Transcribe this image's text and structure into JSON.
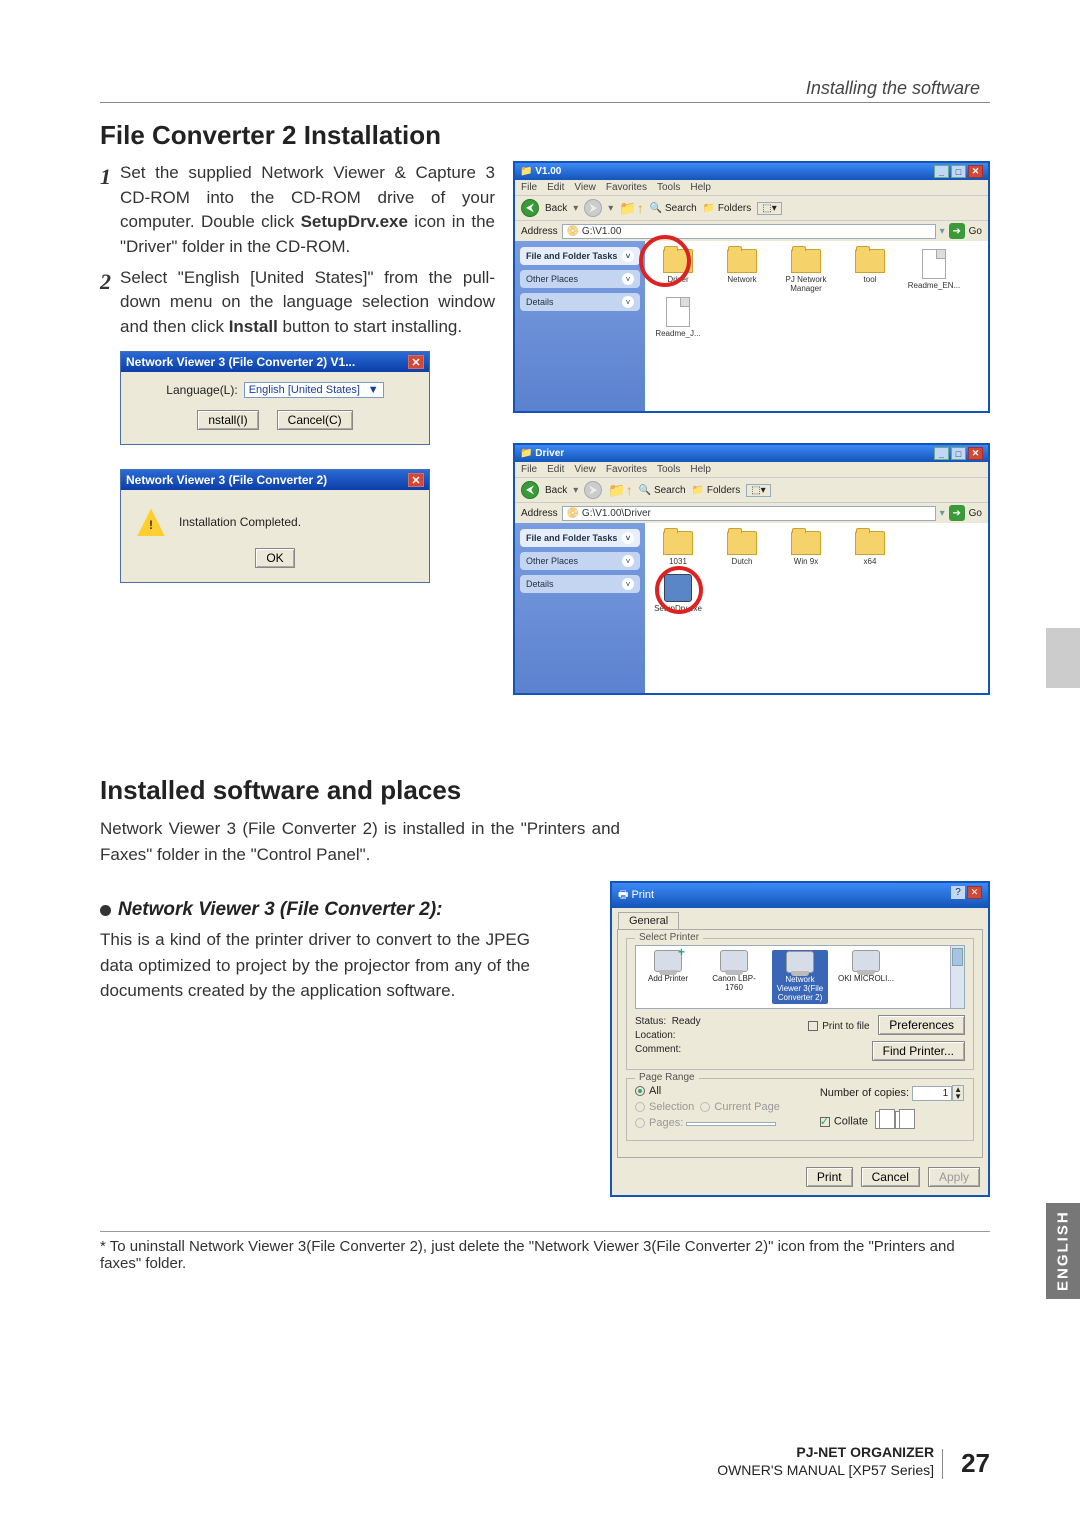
{
  "header": {
    "section": "Installing the software"
  },
  "section1": {
    "title": "File Converter 2 Installation",
    "step1_pre": "Set the supplied Network Viewer & Capture 3 CD-ROM into the CD-ROM drive of your computer. Double click ",
    "step1_bold": "SetupDrv.exe",
    "step1_post": " icon in the \"Driver\" folder in the CD-ROM.",
    "step2_pre": "Select \"English [United States]\" from the pull-down menu on the language selection window and then click ",
    "step2_bold": "Install",
    "step2_post": " button to start installing."
  },
  "dlg_lang": {
    "title": "Network Viewer 3 (File Converter 2) V1...",
    "lang_label": "Language(L):",
    "lang_value": "English [United States]",
    "install": "nstall(I)",
    "cancel": "Cancel(C)"
  },
  "dlg_done": {
    "title": "Network Viewer 3 (File Converter 2)",
    "msg": "Installation Completed.",
    "ok": "OK"
  },
  "explorer_common": {
    "menu": [
      "File",
      "Edit",
      "View",
      "Favorites",
      "Tools",
      "Help"
    ],
    "back": "Back",
    "search": "Search",
    "folders": "Folders",
    "addr_label": "Address",
    "go": "Go",
    "side": {
      "tasks": "File and Folder Tasks",
      "other": "Other Places",
      "details": "Details"
    }
  },
  "exp1": {
    "title": "V1.00",
    "address": "G:\\V1.00",
    "files": [
      {
        "name": "Driver",
        "type": "folder",
        "hi": true
      },
      {
        "name": "Network",
        "type": "folder"
      },
      {
        "name": "PJ Network Manager",
        "type": "folder"
      },
      {
        "name": "tool",
        "type": "folder"
      },
      {
        "name": "Readme_EN...",
        "type": "doc"
      },
      {
        "name": "Readme_J...",
        "type": "doc"
      }
    ]
  },
  "exp2": {
    "title": "Driver",
    "address": "G:\\V1.00\\Driver",
    "files": [
      {
        "name": "1031",
        "type": "folder"
      },
      {
        "name": "Dutch",
        "type": "folder"
      },
      {
        "name": "Win 9x",
        "type": "folder"
      },
      {
        "name": "x64",
        "type": "folder"
      },
      {
        "name": "SetupDrv.exe",
        "type": "exe",
        "hi": true
      }
    ]
  },
  "section2": {
    "title": "Installed software and places",
    "intro": "Network Viewer 3 (File Converter 2) is installed in the \"Printers and Faxes\" folder in the \"Control Panel\".",
    "sub": "Network Viewer 3 (File Converter 2):",
    "desc": "This is a kind of the printer driver to convert to the JPEG data optimized to project by the projector from any of the documents created by the application software."
  },
  "print": {
    "title": "Print",
    "tab": "General",
    "group1": "Select Printer",
    "printers": [
      {
        "name": "Add Printer",
        "type": "add"
      },
      {
        "name": "Canon LBP-1760",
        "type": "p"
      },
      {
        "name": "Network Viewer 3(File Converter 2)",
        "type": "p",
        "sel": true
      },
      {
        "name": "OKI MICROLI...",
        "type": "p"
      }
    ],
    "status_label": "Status:",
    "status_value": "Ready",
    "location_label": "Location:",
    "comment_label": "Comment:",
    "chk_file": "Print to file",
    "pref": "Preferences",
    "find": "Find Printer...",
    "group2": "Page Range",
    "all": "All",
    "selection": "Selection",
    "current": "Current Page",
    "pages": "Pages:",
    "copies_label": "Number of copies:",
    "copies_value": "1",
    "collate": "Collate",
    "btn_print": "Print",
    "btn_cancel": "Cancel",
    "btn_apply": "Apply"
  },
  "footnote": "* To uninstall Network Viewer 3(File Converter 2), just delete the \"Network Viewer 3(File Converter 2)\" icon from the \"Printers and faxes\" folder.",
  "lang_tab": "ENGLISH",
  "footer": {
    "l1": "PJ-NET ORGANIZER",
    "l2": "OWNER'S MANUAL [XP57 Series]",
    "page": "27"
  }
}
